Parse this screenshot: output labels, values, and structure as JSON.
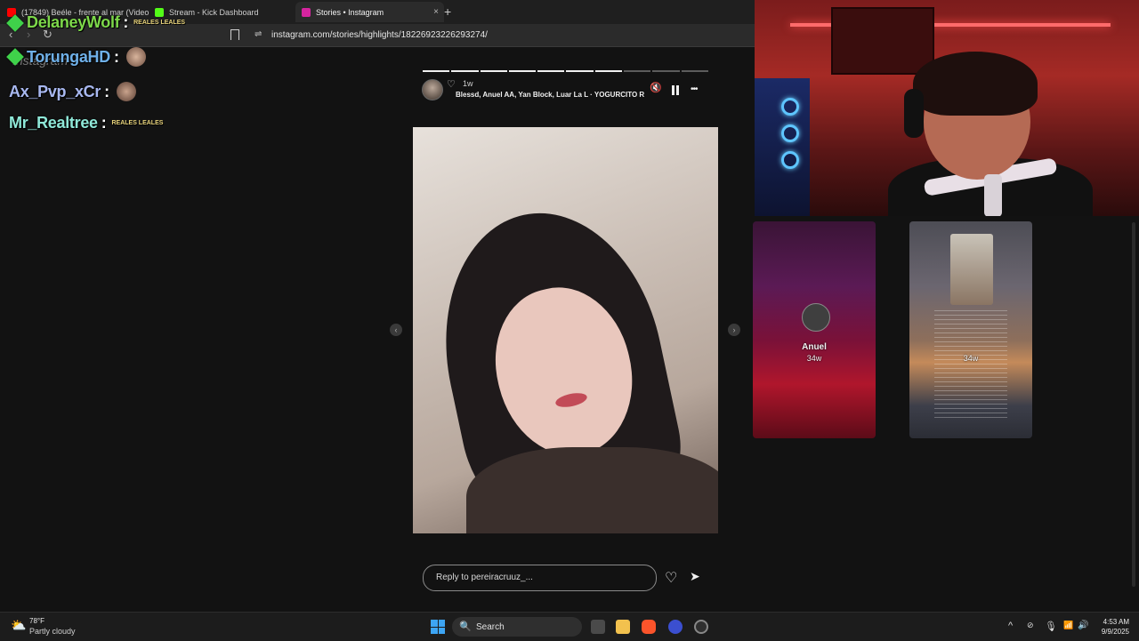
{
  "tabs": [
    {
      "title": "(17849) Beéle - frente al mar (Video",
      "favicon_color": "#ff0000"
    },
    {
      "title": "Stream - Kick Dashboard",
      "favicon_color": "#53fc18"
    },
    {
      "title": "Stories • Instagram",
      "favicon_color": "#d6249f",
      "close": "×"
    }
  ],
  "new_tab": "+",
  "nav": {
    "back": "‹",
    "forward": "›",
    "reload": "↻"
  },
  "url": "instagram.com/stories/highlights/18226923226293274/",
  "chat": [
    {
      "username": "DelaneyWolf",
      "color": "#7dd84a",
      "badge": "REALES LEALES",
      "sep": ":"
    },
    {
      "username": "TorungaHD",
      "color": "#6fb0e8",
      "sep": ":"
    },
    {
      "username": "Ax_Pvp_xCr",
      "color": "#a8b8f0",
      "sep": ":"
    },
    {
      "username": "Mr_Realtree",
      "color": "#8fe8d8",
      "badge": "REALES LEALES",
      "sep": ":"
    }
  ],
  "ghost_text": "Instagram",
  "story": {
    "segments_total": 10,
    "segments_done": 7,
    "time": "1w",
    "music": "Blessd, Anuel AA, Yan Block, Luar La L · YOGURCITO REMIX",
    "reply_placeholder": "Reply to pereiracruuz_..."
  },
  "cards": [
    {
      "username": "Anuel",
      "time": "34w"
    },
    {
      "username": "",
      "time": "34w"
    }
  ],
  "taskbar": {
    "temp": "78°F",
    "condition": "Partly cloudy",
    "search": "Search",
    "time": "4:53 AM",
    "date": "9/9/2025"
  },
  "icons": {
    "mute": "🔇",
    "pause": "pause",
    "more": "•••",
    "heart": "♡",
    "send": "➤",
    "weather": "⛅",
    "search": "🔍",
    "wifi": "📶",
    "volume": "🔊",
    "mic": "🎙",
    "chevron": "^"
  }
}
